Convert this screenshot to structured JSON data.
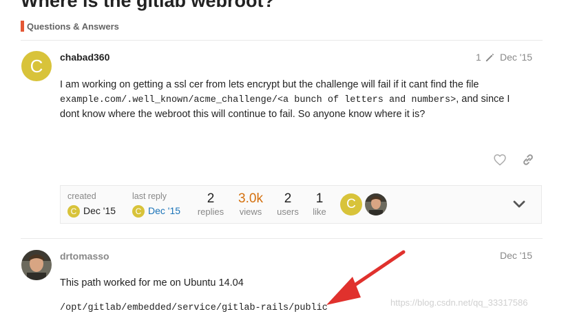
{
  "topic": {
    "title": "Where is the gitlab webroot?",
    "category": "Questions & Answers"
  },
  "colors": {
    "category": "#e45735",
    "avatar": "#d8c33a",
    "views": "#d4700e",
    "link": "#1a73b8",
    "arrow": "#e0312d"
  },
  "post1": {
    "avatar_letter": "C",
    "username": "chabad360",
    "edit_count": "1",
    "date": "Dec '15",
    "body_line1": "I am working on getting a ssl cer from lets encrypt but the challenge will fail if it cant find the file",
    "body_code": "example.com/.well_known/acme_challenge/<a bunch of letters and numbers>",
    "body_line2_tail": ", and since I",
    "body_line3": "dont know where the webroot this will continue to fail. So anyone know where it is?"
  },
  "topic_map": {
    "created_label": "created",
    "created_date": "Dec '15",
    "last_reply_label": "last reply",
    "last_reply_date": "Dec '15",
    "replies_num": "2",
    "replies_label": "replies",
    "views_num": "3.0k",
    "views_label": "views",
    "users_num": "2",
    "users_label": "users",
    "likes_num": "1",
    "likes_label": "like",
    "mini_letter": "C"
  },
  "post2": {
    "username": "drtomasso",
    "date": "Dec '15",
    "body_line1": "This path worked for me on Ubuntu 14.04",
    "body_code": "/opt/gitlab/embedded/service/gitlab-rails/public"
  },
  "watermark": "https://blog.csdn.net/qq_33317586"
}
